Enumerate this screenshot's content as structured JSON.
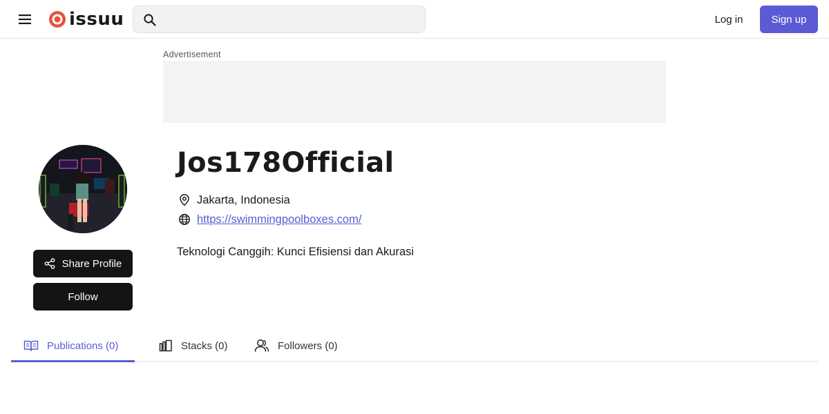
{
  "header": {
    "logo_text": "issuu",
    "search_placeholder": "",
    "login_label": "Log in",
    "signup_label": "Sign up",
    "brand_color": "#e8513d",
    "accent_color": "#5b5bd6"
  },
  "ad": {
    "label": "Advertisement"
  },
  "profile": {
    "name": "Jos178Official",
    "location": "Jakarta, Indonesia",
    "website": "https://swimmingpoolboxes.com/",
    "tagline": "Teknologi Canggih: Kunci Efisiensi dan Akurasi",
    "share_label": "Share Profile",
    "follow_label": "Follow"
  },
  "tabs": [
    {
      "label": "Publications (0)",
      "icon": "book-open-icon",
      "active": true
    },
    {
      "label": "Stacks (0)",
      "icon": "stacks-icon",
      "active": false
    },
    {
      "label": "Followers (0)",
      "icon": "users-icon",
      "active": false
    }
  ]
}
